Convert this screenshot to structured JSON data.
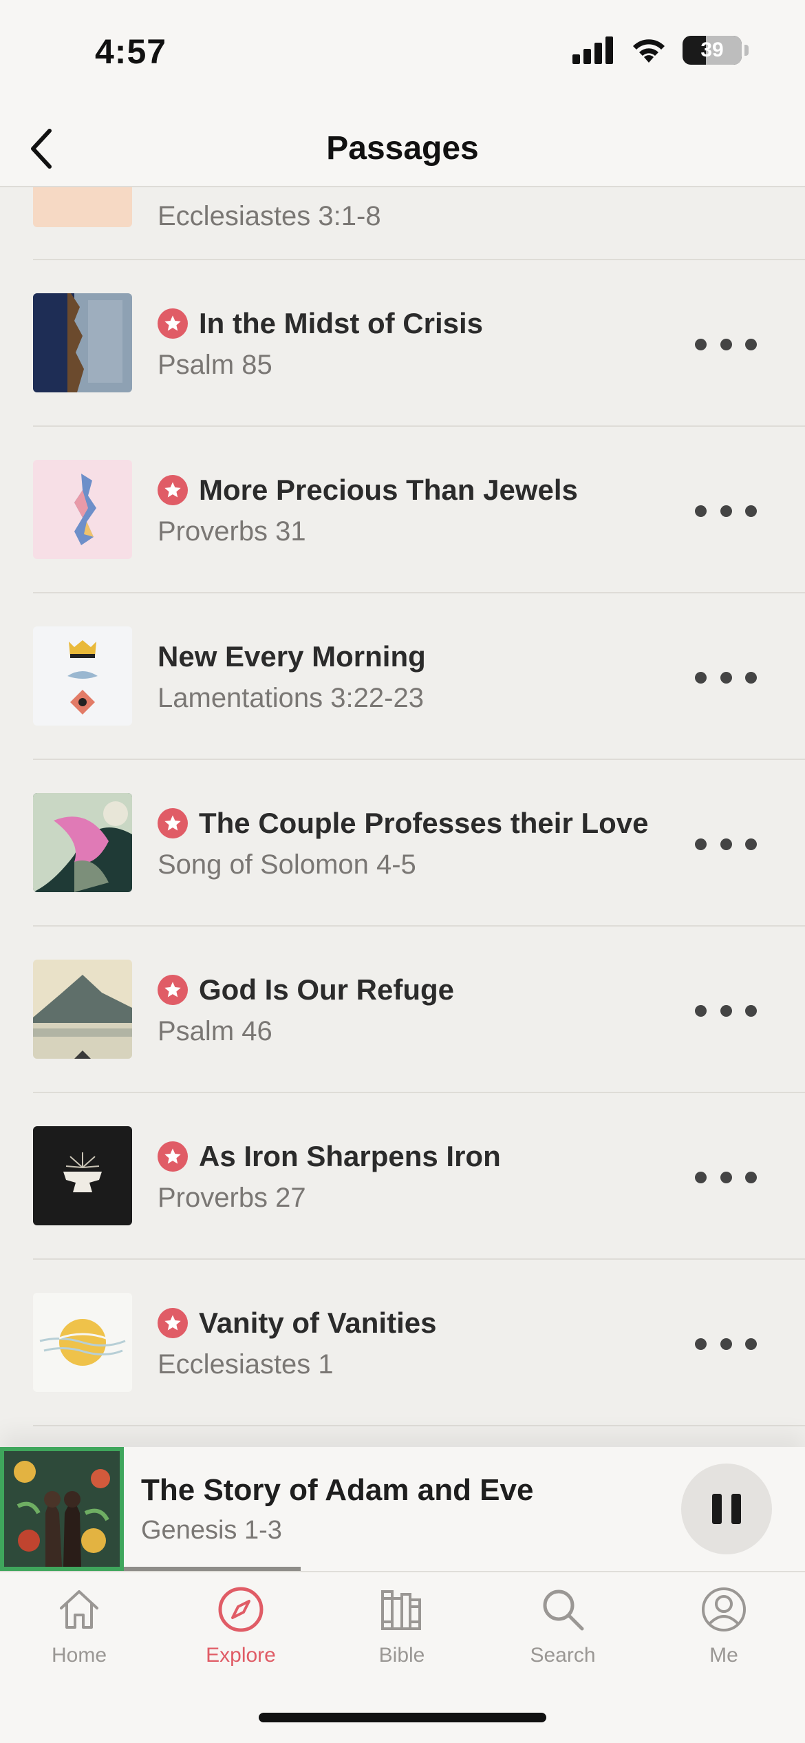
{
  "status_bar": {
    "time": "4:57",
    "battery": "39"
  },
  "nav": {
    "title": "Passages"
  },
  "list": {
    "partial_item": {
      "subtitle": "Ecclesiastes 3:1-8"
    },
    "items": [
      {
        "title": "In the Midst of Crisis",
        "subtitle": "Psalm 85",
        "featured": true
      },
      {
        "title": "More Precious Than Jewels",
        "subtitle": "Proverbs 31",
        "featured": true
      },
      {
        "title": "New Every Morning",
        "subtitle": "Lamentations 3:22-23",
        "featured": false
      },
      {
        "title": "The Couple Professes their Love",
        "subtitle": "Song of Solomon 4-5",
        "featured": true
      },
      {
        "title": "God Is Our Refuge",
        "subtitle": "Psalm 46",
        "featured": true
      },
      {
        "title": "As Iron Sharpens Iron",
        "subtitle": "Proverbs 27",
        "featured": true
      },
      {
        "title": "Vanity of Vanities",
        "subtitle": "Ecclesiastes 1",
        "featured": true
      }
    ]
  },
  "now_playing": {
    "title": "The Story of Adam and Eve",
    "subtitle": "Genesis 1-3",
    "progress": 0.26
  },
  "tab_bar": {
    "tabs": [
      {
        "label": "Home",
        "icon": "home-icon"
      },
      {
        "label": "Explore",
        "icon": "compass-icon",
        "active": true
      },
      {
        "label": "Bible",
        "icon": "books-icon"
      },
      {
        "label": "Search",
        "icon": "search-icon"
      },
      {
        "label": "Me",
        "icon": "profile-icon"
      }
    ]
  },
  "colors": {
    "accent": "#e05c66",
    "background": "#f0efec",
    "now_playing_border": "#3fa65c"
  }
}
